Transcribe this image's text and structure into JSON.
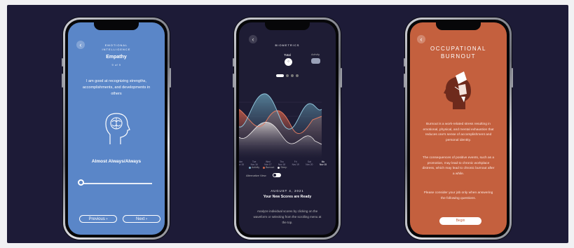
{
  "colors": {
    "stage": "#1d1b37",
    "emotional_bg": "#5a86c8",
    "biometrics_bg": "#1e1c34",
    "burnout_bg": "#c4603e"
  },
  "phone1": {
    "back_icon": "chevron-left-icon",
    "section_title_line1": "EMOTIONAL",
    "section_title_line2": "INTELLIGENCE",
    "heading": "Empathy",
    "progress_text": "9 of 9",
    "statement": "I am good at recognizing strengths, accomplishments, and developments in others",
    "illustration": "head-brain-icon",
    "answer": "Almost Always/Always",
    "slider_value": 0,
    "previous_label": "Previous",
    "next_label": "Next"
  },
  "phone2": {
    "back_icon": "chevron-left-icon",
    "title": "BIOMETRICS",
    "total_label": "Total",
    "activity_label": "Activity",
    "page_indicator": {
      "pages": 4,
      "active": 1
    },
    "x_axis_labels": [
      {
        "top": "Mon",
        "bottom": "Nov 15"
      },
      {
        "top": "Tue",
        "bottom": "Nov 16"
      },
      {
        "top": "Wed",
        "bottom": "Nov 17"
      },
      {
        "top": "Thu",
        "bottom": "Nov 18"
      },
      {
        "top": "Fri",
        "bottom": "Nov 19"
      },
      {
        "top": "Sat",
        "bottom": "Nov 20"
      },
      {
        "top": "Mo",
        "bottom": "Nov 15"
      }
    ],
    "legend": [
      {
        "label": "Activity",
        "color": "#7fb0c8"
      },
      {
        "label": "Burnout",
        "color": "#d06a4c"
      },
      {
        "label": "Sleep",
        "color": "#e5e5e5"
      }
    ],
    "alt_view_label": "Alternative View",
    "date": "AUGUST 4, 2021",
    "scores_heading": "Your New Scores are Ready",
    "instructions": "Analyze individual scores by clicking on the waveform or selecting from the scrolling menu at the top."
  },
  "phone3": {
    "back_icon": "chevron-left-icon",
    "title_line1": "OCCUPATIONAL",
    "title_line2": "BURNOUT",
    "illustration": "burnout-head-icon",
    "paragraph1": "Burnout is a work-related stress resulting in emotional, physical, and mental exhaustion that reduces one's sense of accomplishment and personal identity.",
    "paragraph2": "The consequences of positive events, such as a promotion, may lead to chronic workplace distress, which may lead to chronic burnout after a while.",
    "paragraph3": "Please consider your job only when answering the following questions.",
    "begin_label": "Begin"
  }
}
